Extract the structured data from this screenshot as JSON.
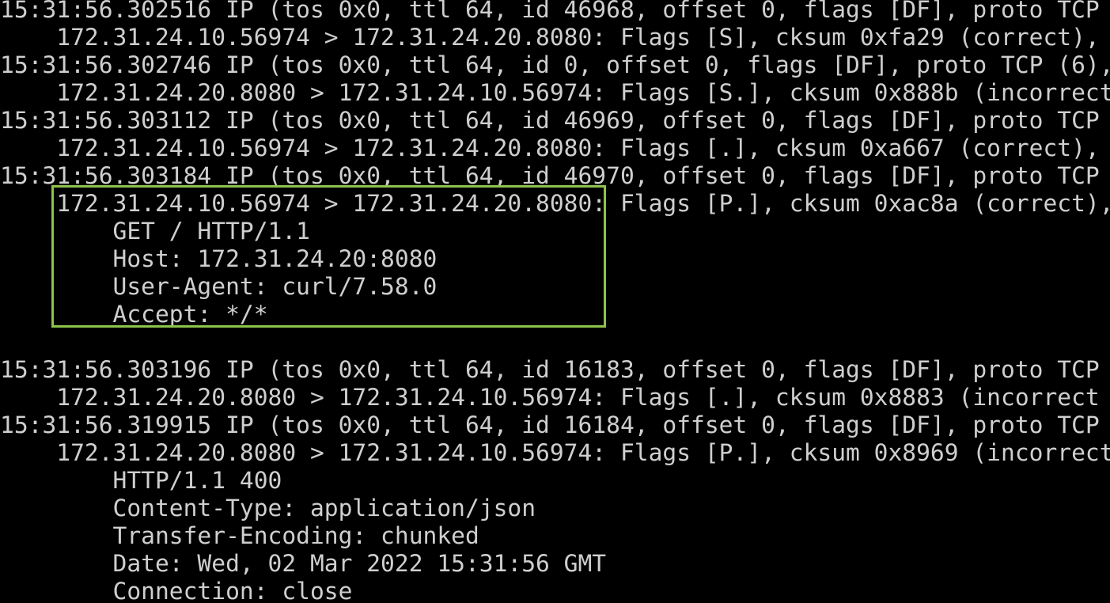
{
  "terminal": {
    "lines": [
      "15:31:56.302516 IP (tos 0x0, ttl 64, id 46968, offset 0, flags [DF], proto TCP",
      "    172.31.24.10.56974 > 172.31.24.20.8080: Flags [S], cksum 0xfa29 (correct),",
      "15:31:56.302746 IP (tos 0x0, ttl 64, id 0, offset 0, flags [DF], proto TCP (6),",
      "    172.31.24.20.8080 > 172.31.24.10.56974: Flags [S.], cksum 0x888b (incorrect",
      "15:31:56.303112 IP (tos 0x0, ttl 64, id 46969, offset 0, flags [DF], proto TCP",
      "    172.31.24.10.56974 > 172.31.24.20.8080: Flags [.], cksum 0xa667 (correct),",
      "15:31:56.303184 IP (tos 0x0, ttl 64, id 46970, offset 0, flags [DF], proto TCP",
      "    172.31.24.10.56974 > 172.31.24.20.8080: Flags [P.], cksum 0xac8a (correct),",
      "        GET / HTTP/1.1",
      "        Host: 172.31.24.20:8080",
      "        User-Agent: curl/7.58.0",
      "        Accept: */*",
      "",
      "15:31:56.303196 IP (tos 0x0, ttl 64, id 16183, offset 0, flags [DF], proto TCP",
      "    172.31.24.20.8080 > 172.31.24.10.56974: Flags [.], cksum 0x8883 (incorrect",
      "15:31:56.319915 IP (tos 0x0, ttl 64, id 16184, offset 0, flags [DF], proto TCP",
      "    172.31.24.20.8080 > 172.31.24.10.56974: Flags [P.], cksum 0x8969 (incorrect",
      "        HTTP/1.1 400",
      "        Content-Type: application/json",
      "        Transfer-Encoding: chunked",
      "        Date: Wed, 02 Mar 2022 15:31:56 GMT",
      "        Connection: close"
    ]
  },
  "colors": {
    "background": "#000000",
    "text": "#cfcfcf",
    "highlight_border": "#8dc34a"
  }
}
